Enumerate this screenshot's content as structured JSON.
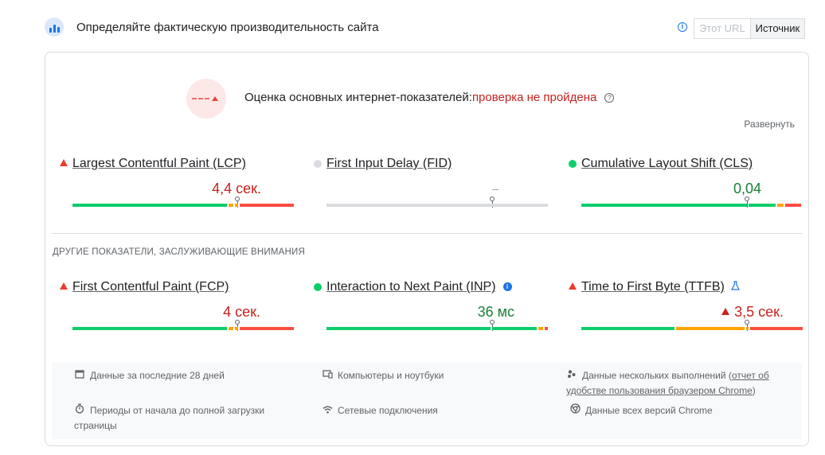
{
  "header": {
    "title": "Определяйте фактическую производительность сайта",
    "toggle_url": "Этот URL",
    "toggle_origin": "Источник"
  },
  "verdict": {
    "label": "Оценка основных интернет-показателей:",
    "status": "проверка не пройдена",
    "expand": "Развернуть"
  },
  "core_metrics": [
    {
      "name": "Largest Contentful Paint (LCP)",
      "value": "4,4 сек.",
      "rating": "poor",
      "marker_percentile": 0.75
    },
    {
      "name": "First Input Delay (FID)",
      "value": "–",
      "rating": "none",
      "marker_percentile": 0.75
    },
    {
      "name": "Cumulative Layout Shift (CLS)",
      "value": "0,04",
      "rating": "good",
      "marker_percentile": 0.75
    }
  ],
  "other_section_title": "Другие показатели, заслуживающие внимания",
  "other_metrics": [
    {
      "name": "First Contentful Paint (FCP)",
      "value": "4 сек.",
      "rating": "poor"
    },
    {
      "name": "Interaction to Next Paint (INP)",
      "value": "36 мс",
      "rating": "good"
    },
    {
      "name": "Time to First Byte (TTFB)",
      "value": "3,5 сек.",
      "rating": "poor"
    }
  ],
  "footer": {
    "period": "Данные за последние 28 дней",
    "devices": "Компьютеры и ноутбуки",
    "samples_prefix": "Данные нескольких выполнений (",
    "samples_link": "отчет об удобстве пользования браузером Chrome",
    "samples_suffix": ")",
    "duration": "Периоды от начала до полной загрузки страницы",
    "network": "Сетевые подключения",
    "chrome": "Данные всех версий Chrome"
  },
  "colors": {
    "good": "#0cce6b",
    "average": "#ffa400",
    "poor": "#ff4e42",
    "fail_text": "#c5221f",
    "pass_text": "#188038",
    "accent": "#1a73e8"
  }
}
